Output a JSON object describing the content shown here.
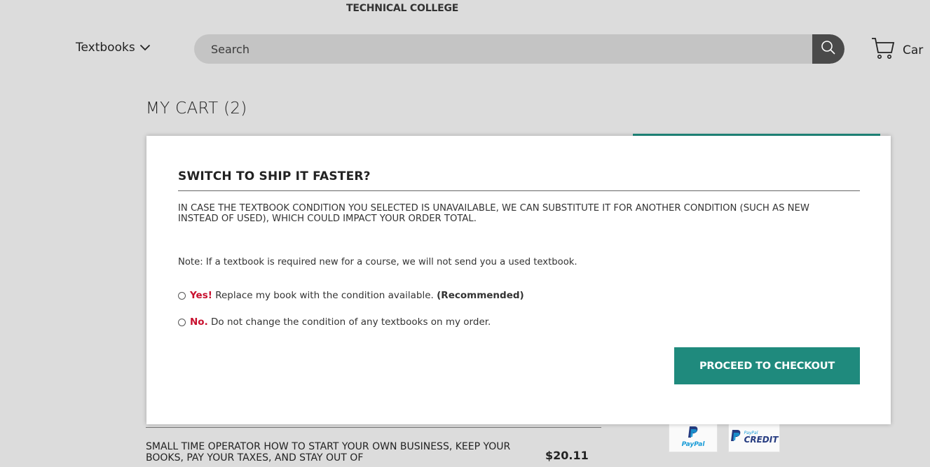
{
  "header": {
    "college_name": "TECHNICAL COLLEGE",
    "textbooks_menu_label": "Textbooks",
    "search_placeholder": "Search",
    "cart_label": "Car"
  },
  "cart": {
    "title": "MY CART (2)",
    "item": {
      "title": "SMALL TIME OPERATOR HOW TO START YOUR OWN BUSINESS, KEEP YOUR BOOKS, PAY YOUR TAXES, AND STAY OUT OF",
      "price": "$20.11"
    },
    "payment": {
      "paypal_label": "PayPal",
      "paypal_credit_small": "PayPal",
      "paypal_credit_label": "CREDIT"
    }
  },
  "modal": {
    "title": "SWITCH TO SHIP IT FASTER?",
    "description": "IN CASE THE TEXTBOOK CONDITION YOU SELECTED IS UNAVAILABLE, WE CAN SUBSTITUTE IT FOR ANOTHER CONDITION (SUCH AS NEW INSTEAD OF USED), WHICH COULD IMPACT YOUR ORDER TOTAL.",
    "note": "Note: If a textbook is required new for a course, we will not send you a used textbook.",
    "option_yes": {
      "lead": "Yes!",
      "text": "Replace my book with the condition available.",
      "recommended": "(Recommended)"
    },
    "option_no": {
      "lead": "No.",
      "text": "Do not change the condition of any textbooks on my order."
    },
    "checkout_button": "PROCEED TO CHECKOUT"
  },
  "colors": {
    "accent_teal": "#1f8a7d",
    "alert_red": "#c8102e",
    "overlay_gray": "#dcdcdc"
  },
  "icons": [
    "chevron-down-icon",
    "search-icon",
    "cart-icon",
    "paypal-logo-icon"
  ]
}
